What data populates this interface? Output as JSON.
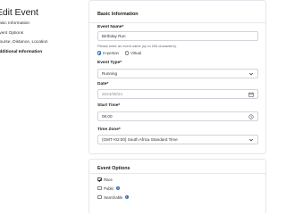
{
  "page": {
    "title": "Edit Event"
  },
  "sidebar": {
    "items": [
      {
        "label": "Basic Information",
        "active": false
      },
      {
        "label": "Event Options",
        "active": false
      },
      {
        "label": "Course, Distance, Location",
        "active": false
      },
      {
        "label": "Additional Information",
        "active": true
      }
    ]
  },
  "basic": {
    "title": "Basic Information",
    "event_name": {
      "label": "Event Name*",
      "value": "Birthday Run",
      "hint": "Please enter an event name (up to 254 characters)."
    },
    "mode": {
      "options": [
        "In-person",
        "Virtual"
      ],
      "selected": "In-person"
    },
    "event_type": {
      "label": "Event Type*",
      "value": "Running"
    },
    "date": {
      "label": "Date*",
      "value": "2024/09/24"
    },
    "start_time": {
      "label": "Start Time*",
      "value": "06:00"
    },
    "time_zone": {
      "label": "Time Zone*",
      "value": "(GMT+02:00) South Africa Standard Time"
    }
  },
  "options": {
    "title": "Event Options",
    "items": [
      {
        "label": "Race",
        "checked": true,
        "info": false
      },
      {
        "label": "Public",
        "checked": false,
        "info": true
      },
      {
        "label": "Searchable",
        "checked": false,
        "info": true
      }
    ]
  },
  "colors": {
    "accent": "#2e6fb6",
    "border": "#cfd4da"
  },
  "icons": {
    "select": "chevron-down-icon",
    "date": "calendar-icon",
    "time": "clock-icon",
    "info": "info-icon"
  }
}
